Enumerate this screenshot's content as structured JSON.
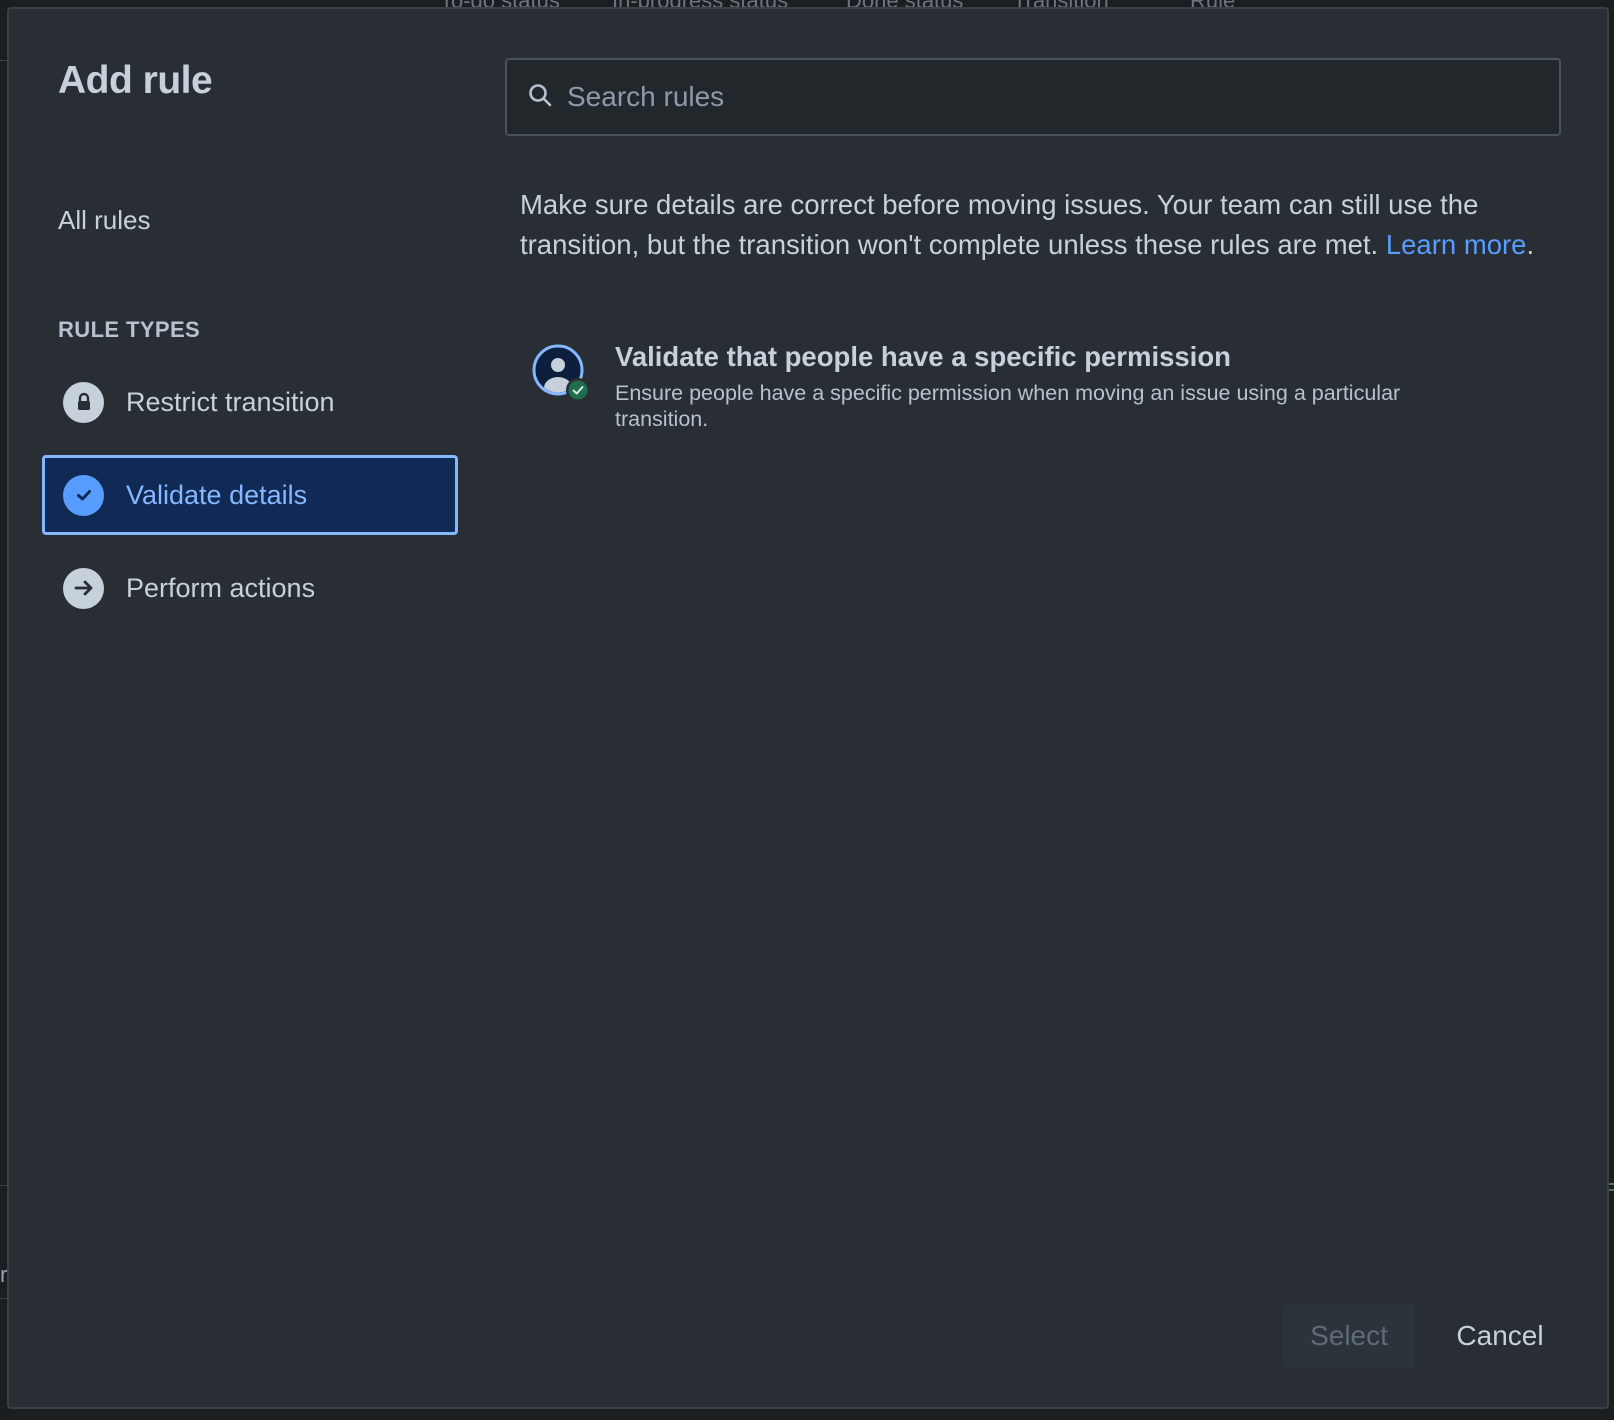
{
  "background": {
    "columns": [
      "To-do status",
      "In-progress status",
      "Done status",
      "Transition",
      "Rule"
    ],
    "fragment": "r"
  },
  "modal": {
    "title": "Add rule",
    "all_rules": "All rules",
    "section_heading": "RULE TYPES",
    "nav": [
      {
        "label": "Restrict transition",
        "icon": "lock-icon",
        "selected": false
      },
      {
        "label": "Validate details",
        "icon": "check-circle-icon",
        "selected": true
      },
      {
        "label": "Perform actions",
        "icon": "arrow-right-icon",
        "selected": false
      }
    ],
    "search": {
      "placeholder": "Search rules",
      "value": ""
    },
    "description": "Make sure details are correct before moving issues. Your team can still use the transition, but the transition won't complete unless these rules are met.",
    "learn_more": "Learn more",
    "description_end": ".",
    "rules": [
      {
        "title": "Validate that people have a specific permission",
        "description": "Ensure people have a specific permission when moving an issue using a particular transition.",
        "icon": "user-permission-icon"
      }
    ],
    "buttons": {
      "select": "Select",
      "cancel": "Cancel"
    }
  },
  "colors": {
    "surface": "#282e33",
    "text": "#c7d1db",
    "link": "#579dff",
    "selected_bg": "#102a55",
    "selected_border": "#85b8ff",
    "success": "#22a06b"
  }
}
